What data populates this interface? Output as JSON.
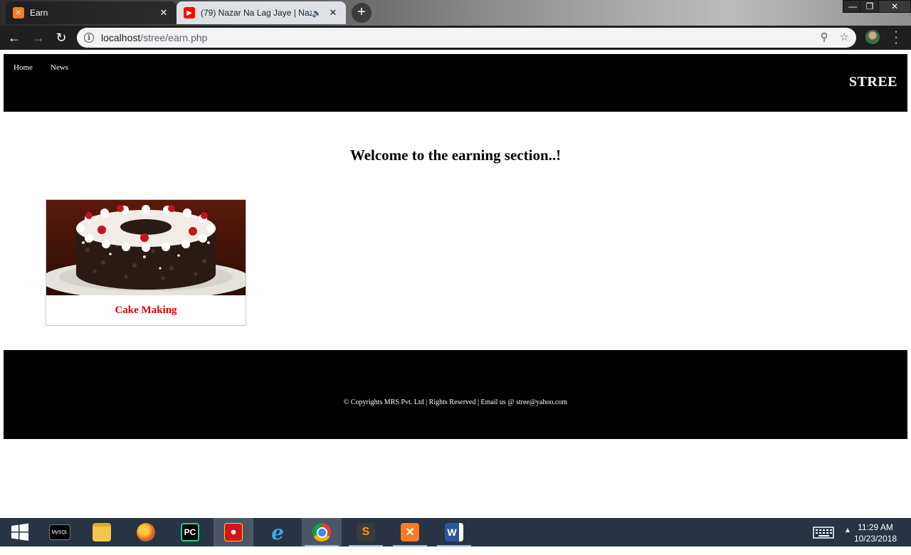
{
  "browser": {
    "tabs": [
      {
        "title": "Earn",
        "favicon": "xampp-icon",
        "active": false
      },
      {
        "title": "(79) Nazar Na Lag Jaye | Nazar",
        "favicon": "youtube-icon",
        "active": true,
        "audio": true
      }
    ],
    "url_host": "localhost",
    "url_path": "/stree/earn.php"
  },
  "site": {
    "nav": [
      {
        "label": "Home"
      },
      {
        "label": "News"
      }
    ],
    "brand": "STREE",
    "welcome": "Welcome to the earning section..!",
    "cards": [
      {
        "title": "Cake Making",
        "image": "black-forest-cake-image"
      }
    ],
    "footer": "© Copyrights MRS Pvt. Ltd | Rights Reserved | Email us @ stree@yahoo.com"
  },
  "taskbar": {
    "time": "11:29 AM",
    "date": "10/23/2018",
    "mysql_label": "MySQL"
  },
  "colors": {
    "header_bg": "#000000",
    "card_title": "#e00000",
    "taskbar_bg": "#283443"
  }
}
